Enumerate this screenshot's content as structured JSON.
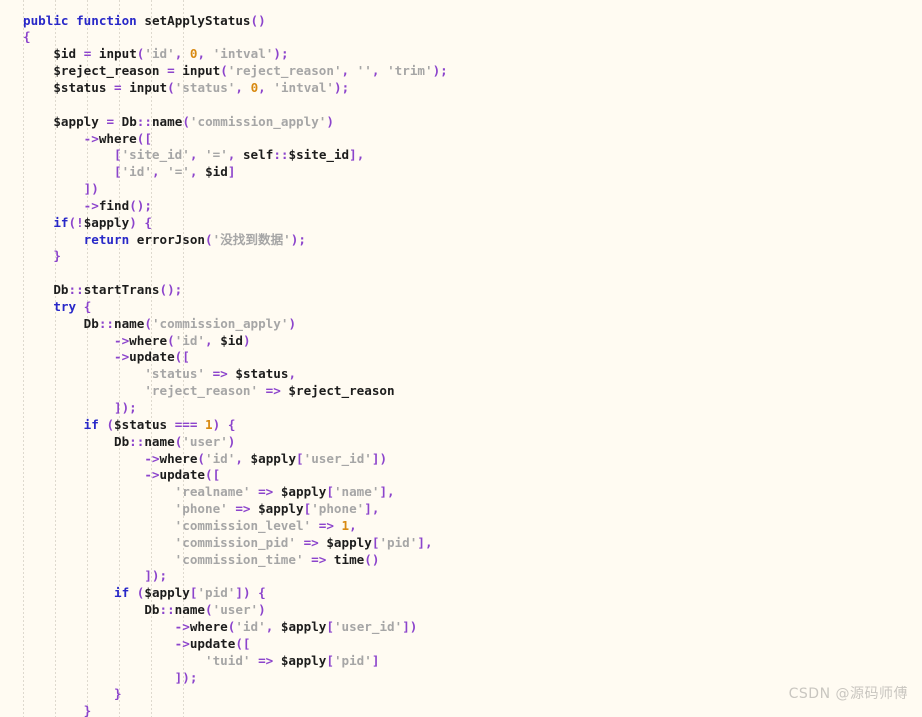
{
  "editor": {
    "language": "php",
    "background_color": "#fffbf2",
    "indent_guide_color": "#d8d3c8",
    "indent_guide_positions": [
      23,
      55,
      87,
      119,
      151,
      183
    ],
    "line_height": 16.85,
    "font_size": 12.6,
    "theme_colors": {
      "keyword": "#2828c8",
      "identifier": "#1c1c1c",
      "string": "#a6a6a6",
      "number": "#d88a12",
      "punctuation": "#8c44cc",
      "text": "#1c1c1c"
    }
  },
  "watermark": {
    "text": "CSDN @源码师傅"
  },
  "code": {
    "lines": [
      "public function setApplyStatus()",
      "{",
      "    $id = input('id', 0, 'intval');",
      "    $reject_reason = input('reject_reason', '', 'trim');",
      "    $status = input('status', 0, 'intval');",
      "",
      "    $apply = Db::name('commission_apply')",
      "        ->where([",
      "            ['site_id', '=', self::$site_id],",
      "            ['id', '=', $id]",
      "        ])",
      "        ->find();",
      "    if(!$apply) {",
      "        return errorJson('没找到数据');",
      "    }",
      "",
      "    Db::startTrans();",
      "    try {",
      "        Db::name('commission_apply')",
      "            ->where('id', $id)",
      "            ->update([",
      "                'status' => $status,",
      "                'reject_reason' => $reject_reason",
      "            ]);",
      "        if ($status === 1) {",
      "            Db::name('user')",
      "                ->where('id', $apply['user_id'])",
      "                ->update([",
      "                    'realname' => $apply['name'],",
      "                    'phone' => $apply['phone'],",
      "                    'commission_level' => 1,",
      "                    'commission_pid' => $apply['pid'],",
      "                    'commission_time' => time()",
      "                ]);",
      "            if ($apply['pid']) {",
      "                Db::name('user')",
      "                    ->where('id', $apply['user_id'])",
      "                    ->update([",
      "                        'tuid' => $apply['pid']",
      "                    ]);",
      "            }",
      "        }"
    ],
    "tokens": [
      [
        [
          "kw",
          "public"
        ],
        [
          "plain",
          " "
        ],
        [
          "kw",
          "function"
        ],
        [
          "plain",
          " "
        ],
        [
          "fn",
          "setApplyStatus"
        ],
        [
          "pct",
          "()"
        ]
      ],
      [
        [
          "pct",
          "{"
        ]
      ],
      [
        [
          "plain",
          "    "
        ],
        [
          "var",
          "$id"
        ],
        [
          "plain",
          " "
        ],
        [
          "pct",
          "="
        ],
        [
          "plain",
          " "
        ],
        [
          "fn",
          "input"
        ],
        [
          "pct",
          "("
        ],
        [
          "str",
          "'id'"
        ],
        [
          "pct",
          ","
        ],
        [
          "plain",
          " "
        ],
        [
          "num",
          "0"
        ],
        [
          "pct",
          ","
        ],
        [
          "plain",
          " "
        ],
        [
          "str",
          "'intval'"
        ],
        [
          "pct",
          ");"
        ]
      ],
      [
        [
          "plain",
          "    "
        ],
        [
          "var",
          "$reject_reason"
        ],
        [
          "plain",
          " "
        ],
        [
          "pct",
          "="
        ],
        [
          "plain",
          " "
        ],
        [
          "fn",
          "input"
        ],
        [
          "pct",
          "("
        ],
        [
          "str",
          "'reject_reason'"
        ],
        [
          "pct",
          ","
        ],
        [
          "plain",
          " "
        ],
        [
          "str",
          "''"
        ],
        [
          "pct",
          ","
        ],
        [
          "plain",
          " "
        ],
        [
          "str",
          "'trim'"
        ],
        [
          "pct",
          ");"
        ]
      ],
      [
        [
          "plain",
          "    "
        ],
        [
          "var",
          "$status"
        ],
        [
          "plain",
          " "
        ],
        [
          "pct",
          "="
        ],
        [
          "plain",
          " "
        ],
        [
          "fn",
          "input"
        ],
        [
          "pct",
          "("
        ],
        [
          "str",
          "'status'"
        ],
        [
          "pct",
          ","
        ],
        [
          "plain",
          " "
        ],
        [
          "num",
          "0"
        ],
        [
          "pct",
          ","
        ],
        [
          "plain",
          " "
        ],
        [
          "str",
          "'intval'"
        ],
        [
          "pct",
          ");"
        ]
      ],
      [],
      [
        [
          "plain",
          "    "
        ],
        [
          "var",
          "$apply"
        ],
        [
          "plain",
          " "
        ],
        [
          "pct",
          "="
        ],
        [
          "plain",
          " "
        ],
        [
          "fn",
          "Db"
        ],
        [
          "pct",
          "::"
        ],
        [
          "fn",
          "name"
        ],
        [
          "pct",
          "("
        ],
        [
          "str",
          "'commission_apply'"
        ],
        [
          "pct",
          ")"
        ]
      ],
      [
        [
          "plain",
          "        "
        ],
        [
          "pct",
          "->"
        ],
        [
          "fn",
          "where"
        ],
        [
          "pct",
          "(["
        ]
      ],
      [
        [
          "plain",
          "            "
        ],
        [
          "pct",
          "["
        ],
        [
          "str",
          "'site_id'"
        ],
        [
          "pct",
          ","
        ],
        [
          "plain",
          " "
        ],
        [
          "str",
          "'='"
        ],
        [
          "pct",
          ","
        ],
        [
          "plain",
          " "
        ],
        [
          "fn",
          "self"
        ],
        [
          "pct",
          "::"
        ],
        [
          "var",
          "$site_id"
        ],
        [
          "pct",
          "],"
        ]
      ],
      [
        [
          "plain",
          "            "
        ],
        [
          "pct",
          "["
        ],
        [
          "str",
          "'id'"
        ],
        [
          "pct",
          ","
        ],
        [
          "plain",
          " "
        ],
        [
          "str",
          "'='"
        ],
        [
          "pct",
          ","
        ],
        [
          "plain",
          " "
        ],
        [
          "var",
          "$id"
        ],
        [
          "pct",
          "]"
        ]
      ],
      [
        [
          "plain",
          "        "
        ],
        [
          "pct",
          "])"
        ]
      ],
      [
        [
          "plain",
          "        "
        ],
        [
          "pct",
          "->"
        ],
        [
          "fn",
          "find"
        ],
        [
          "pct",
          "();"
        ]
      ],
      [
        [
          "plain",
          "    "
        ],
        [
          "kw",
          "if"
        ],
        [
          "pct",
          "(!"
        ],
        [
          "var",
          "$apply"
        ],
        [
          "pct",
          ")"
        ],
        [
          "plain",
          " "
        ],
        [
          "pct",
          "{"
        ]
      ],
      [
        [
          "plain",
          "        "
        ],
        [
          "kw",
          "return"
        ],
        [
          "plain",
          " "
        ],
        [
          "fn",
          "errorJson"
        ],
        [
          "pct",
          "("
        ],
        [
          "str",
          "'没找到数据'"
        ],
        [
          "pct",
          ");"
        ]
      ],
      [
        [
          "plain",
          "    "
        ],
        [
          "pct",
          "}"
        ]
      ],
      [],
      [
        [
          "plain",
          "    "
        ],
        [
          "fn",
          "Db"
        ],
        [
          "pct",
          "::"
        ],
        [
          "fn",
          "startTrans"
        ],
        [
          "pct",
          "();"
        ]
      ],
      [
        [
          "plain",
          "    "
        ],
        [
          "kw",
          "try"
        ],
        [
          "plain",
          " "
        ],
        [
          "pct",
          "{"
        ]
      ],
      [
        [
          "plain",
          "        "
        ],
        [
          "fn",
          "Db"
        ],
        [
          "pct",
          "::"
        ],
        [
          "fn",
          "name"
        ],
        [
          "pct",
          "("
        ],
        [
          "str",
          "'commission_apply'"
        ],
        [
          "pct",
          ")"
        ]
      ],
      [
        [
          "plain",
          "            "
        ],
        [
          "pct",
          "->"
        ],
        [
          "fn",
          "where"
        ],
        [
          "pct",
          "("
        ],
        [
          "str",
          "'id'"
        ],
        [
          "pct",
          ","
        ],
        [
          "plain",
          " "
        ],
        [
          "var",
          "$id"
        ],
        [
          "pct",
          ")"
        ]
      ],
      [
        [
          "plain",
          "            "
        ],
        [
          "pct",
          "->"
        ],
        [
          "fn",
          "update"
        ],
        [
          "pct",
          "(["
        ]
      ],
      [
        [
          "plain",
          "                "
        ],
        [
          "str",
          "'status'"
        ],
        [
          "plain",
          " "
        ],
        [
          "pct",
          "=>"
        ],
        [
          "plain",
          " "
        ],
        [
          "var",
          "$status"
        ],
        [
          "pct",
          ","
        ]
      ],
      [
        [
          "plain",
          "                "
        ],
        [
          "str",
          "'reject_reason'"
        ],
        [
          "plain",
          " "
        ],
        [
          "pct",
          "=>"
        ],
        [
          "plain",
          " "
        ],
        [
          "var",
          "$reject_reason"
        ]
      ],
      [
        [
          "plain",
          "            "
        ],
        [
          "pct",
          "]);"
        ]
      ],
      [
        [
          "plain",
          "        "
        ],
        [
          "kw",
          "if"
        ],
        [
          "plain",
          " "
        ],
        [
          "pct",
          "("
        ],
        [
          "var",
          "$status"
        ],
        [
          "plain",
          " "
        ],
        [
          "pct",
          "==="
        ],
        [
          "plain",
          " "
        ],
        [
          "num",
          "1"
        ],
        [
          "pct",
          ")"
        ],
        [
          "plain",
          " "
        ],
        [
          "pct",
          "{"
        ]
      ],
      [
        [
          "plain",
          "            "
        ],
        [
          "fn",
          "Db"
        ],
        [
          "pct",
          "::"
        ],
        [
          "fn",
          "name"
        ],
        [
          "pct",
          "("
        ],
        [
          "str",
          "'user'"
        ],
        [
          "pct",
          ")"
        ]
      ],
      [
        [
          "plain",
          "                "
        ],
        [
          "pct",
          "->"
        ],
        [
          "fn",
          "where"
        ],
        [
          "pct",
          "("
        ],
        [
          "str",
          "'id'"
        ],
        [
          "pct",
          ","
        ],
        [
          "plain",
          " "
        ],
        [
          "var",
          "$apply"
        ],
        [
          "pct",
          "["
        ],
        [
          "str",
          "'user_id'"
        ],
        [
          "pct",
          "])"
        ]
      ],
      [
        [
          "plain",
          "                "
        ],
        [
          "pct",
          "->"
        ],
        [
          "fn",
          "update"
        ],
        [
          "pct",
          "(["
        ]
      ],
      [
        [
          "plain",
          "                    "
        ],
        [
          "str",
          "'realname'"
        ],
        [
          "plain",
          " "
        ],
        [
          "pct",
          "=>"
        ],
        [
          "plain",
          " "
        ],
        [
          "var",
          "$apply"
        ],
        [
          "pct",
          "["
        ],
        [
          "str",
          "'name'"
        ],
        [
          "pct",
          "],"
        ]
      ],
      [
        [
          "plain",
          "                    "
        ],
        [
          "str",
          "'phone'"
        ],
        [
          "plain",
          " "
        ],
        [
          "pct",
          "=>"
        ],
        [
          "plain",
          " "
        ],
        [
          "var",
          "$apply"
        ],
        [
          "pct",
          "["
        ],
        [
          "str",
          "'phone'"
        ],
        [
          "pct",
          "],"
        ]
      ],
      [
        [
          "plain",
          "                    "
        ],
        [
          "str",
          "'commission_level'"
        ],
        [
          "plain",
          " "
        ],
        [
          "pct",
          "=>"
        ],
        [
          "plain",
          " "
        ],
        [
          "num",
          "1"
        ],
        [
          "pct",
          ","
        ]
      ],
      [
        [
          "plain",
          "                    "
        ],
        [
          "str",
          "'commission_pid'"
        ],
        [
          "plain",
          " "
        ],
        [
          "pct",
          "=>"
        ],
        [
          "plain",
          " "
        ],
        [
          "var",
          "$apply"
        ],
        [
          "pct",
          "["
        ],
        [
          "str",
          "'pid'"
        ],
        [
          "pct",
          "],"
        ]
      ],
      [
        [
          "plain",
          "                    "
        ],
        [
          "str",
          "'commission_time'"
        ],
        [
          "plain",
          " "
        ],
        [
          "pct",
          "=>"
        ],
        [
          "plain",
          " "
        ],
        [
          "fn",
          "time"
        ],
        [
          "pct",
          "()"
        ]
      ],
      [
        [
          "plain",
          "                "
        ],
        [
          "pct",
          "]);"
        ]
      ],
      [
        [
          "plain",
          "            "
        ],
        [
          "kw",
          "if"
        ],
        [
          "plain",
          " "
        ],
        [
          "pct",
          "("
        ],
        [
          "var",
          "$apply"
        ],
        [
          "pct",
          "["
        ],
        [
          "str",
          "'pid'"
        ],
        [
          "pct",
          "])"
        ],
        [
          "plain",
          " "
        ],
        [
          "pct",
          "{"
        ]
      ],
      [
        [
          "plain",
          "                "
        ],
        [
          "fn",
          "Db"
        ],
        [
          "pct",
          "::"
        ],
        [
          "fn",
          "name"
        ],
        [
          "pct",
          "("
        ],
        [
          "str",
          "'user'"
        ],
        [
          "pct",
          ")"
        ]
      ],
      [
        [
          "plain",
          "                    "
        ],
        [
          "pct",
          "->"
        ],
        [
          "fn",
          "where"
        ],
        [
          "pct",
          "("
        ],
        [
          "str",
          "'id'"
        ],
        [
          "pct",
          ","
        ],
        [
          "plain",
          " "
        ],
        [
          "var",
          "$apply"
        ],
        [
          "pct",
          "["
        ],
        [
          "str",
          "'user_id'"
        ],
        [
          "pct",
          "])"
        ]
      ],
      [
        [
          "plain",
          "                    "
        ],
        [
          "pct",
          "->"
        ],
        [
          "fn",
          "update"
        ],
        [
          "pct",
          "(["
        ]
      ],
      [
        [
          "plain",
          "                        "
        ],
        [
          "str",
          "'tuid'"
        ],
        [
          "plain",
          " "
        ],
        [
          "pct",
          "=>"
        ],
        [
          "plain",
          " "
        ],
        [
          "var",
          "$apply"
        ],
        [
          "pct",
          "["
        ],
        [
          "str",
          "'pid'"
        ],
        [
          "pct",
          "]"
        ]
      ],
      [
        [
          "plain",
          "                    "
        ],
        [
          "pct",
          "]);"
        ]
      ],
      [
        [
          "plain",
          "            "
        ],
        [
          "pct",
          "}"
        ]
      ],
      [
        [
          "plain",
          "        "
        ],
        [
          "pct",
          "}"
        ]
      ]
    ]
  }
}
